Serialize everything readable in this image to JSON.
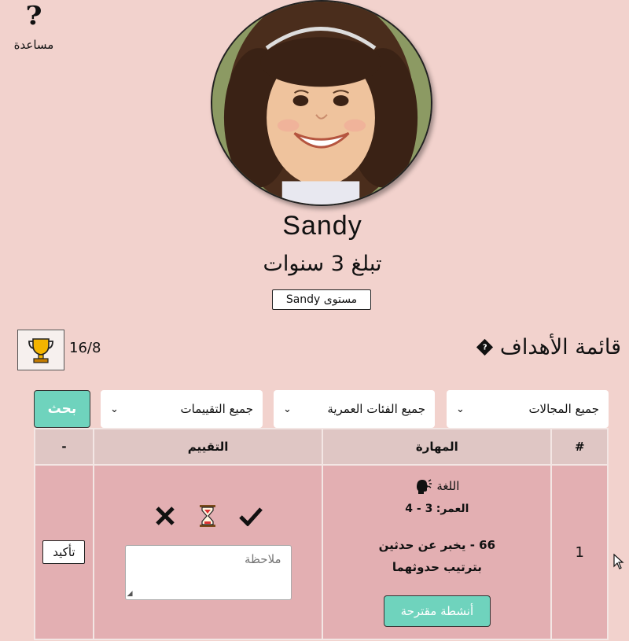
{
  "help": {
    "icon": "question-mark-icon",
    "label": "مساعدة"
  },
  "profile": {
    "name": "Sandy",
    "age_text": "تبلغ 3 سنوات",
    "level_button": "مستوى Sandy"
  },
  "score": {
    "icon": "trophy-icon",
    "value": "16/8"
  },
  "goals": {
    "title": "قائمة الأهداف",
    "title_icon": "diamond-question-icon",
    "filters": {
      "domains": "جميع المجالات",
      "age_groups": "جميع الفئات العمرية",
      "evaluations": "جميع التقييمات"
    },
    "search_label": "بحث",
    "columns": [
      "#",
      "المهارة",
      "التقييم",
      "-"
    ],
    "rows": [
      {
        "number": "1",
        "domain_icon": "speaking-head-icon",
        "domain": "اللغة",
        "age_label": "العمر:",
        "age_value": "3 - 4",
        "skill": "66 - يخبر عن حدثين بترتيب حدوثهما",
        "activities_label": "أنشطة مقترحة",
        "eval_icons": [
          "check-icon",
          "hourglass-icon",
          "cross-icon"
        ],
        "note_placeholder": "ملاحظة",
        "confirm_label": "تأكيد"
      }
    ]
  },
  "colors": {
    "background": "#f2d2cd",
    "accent": "#6fd3bd",
    "header_row": "#dfc6c4",
    "body_row": "#e3afb2"
  }
}
